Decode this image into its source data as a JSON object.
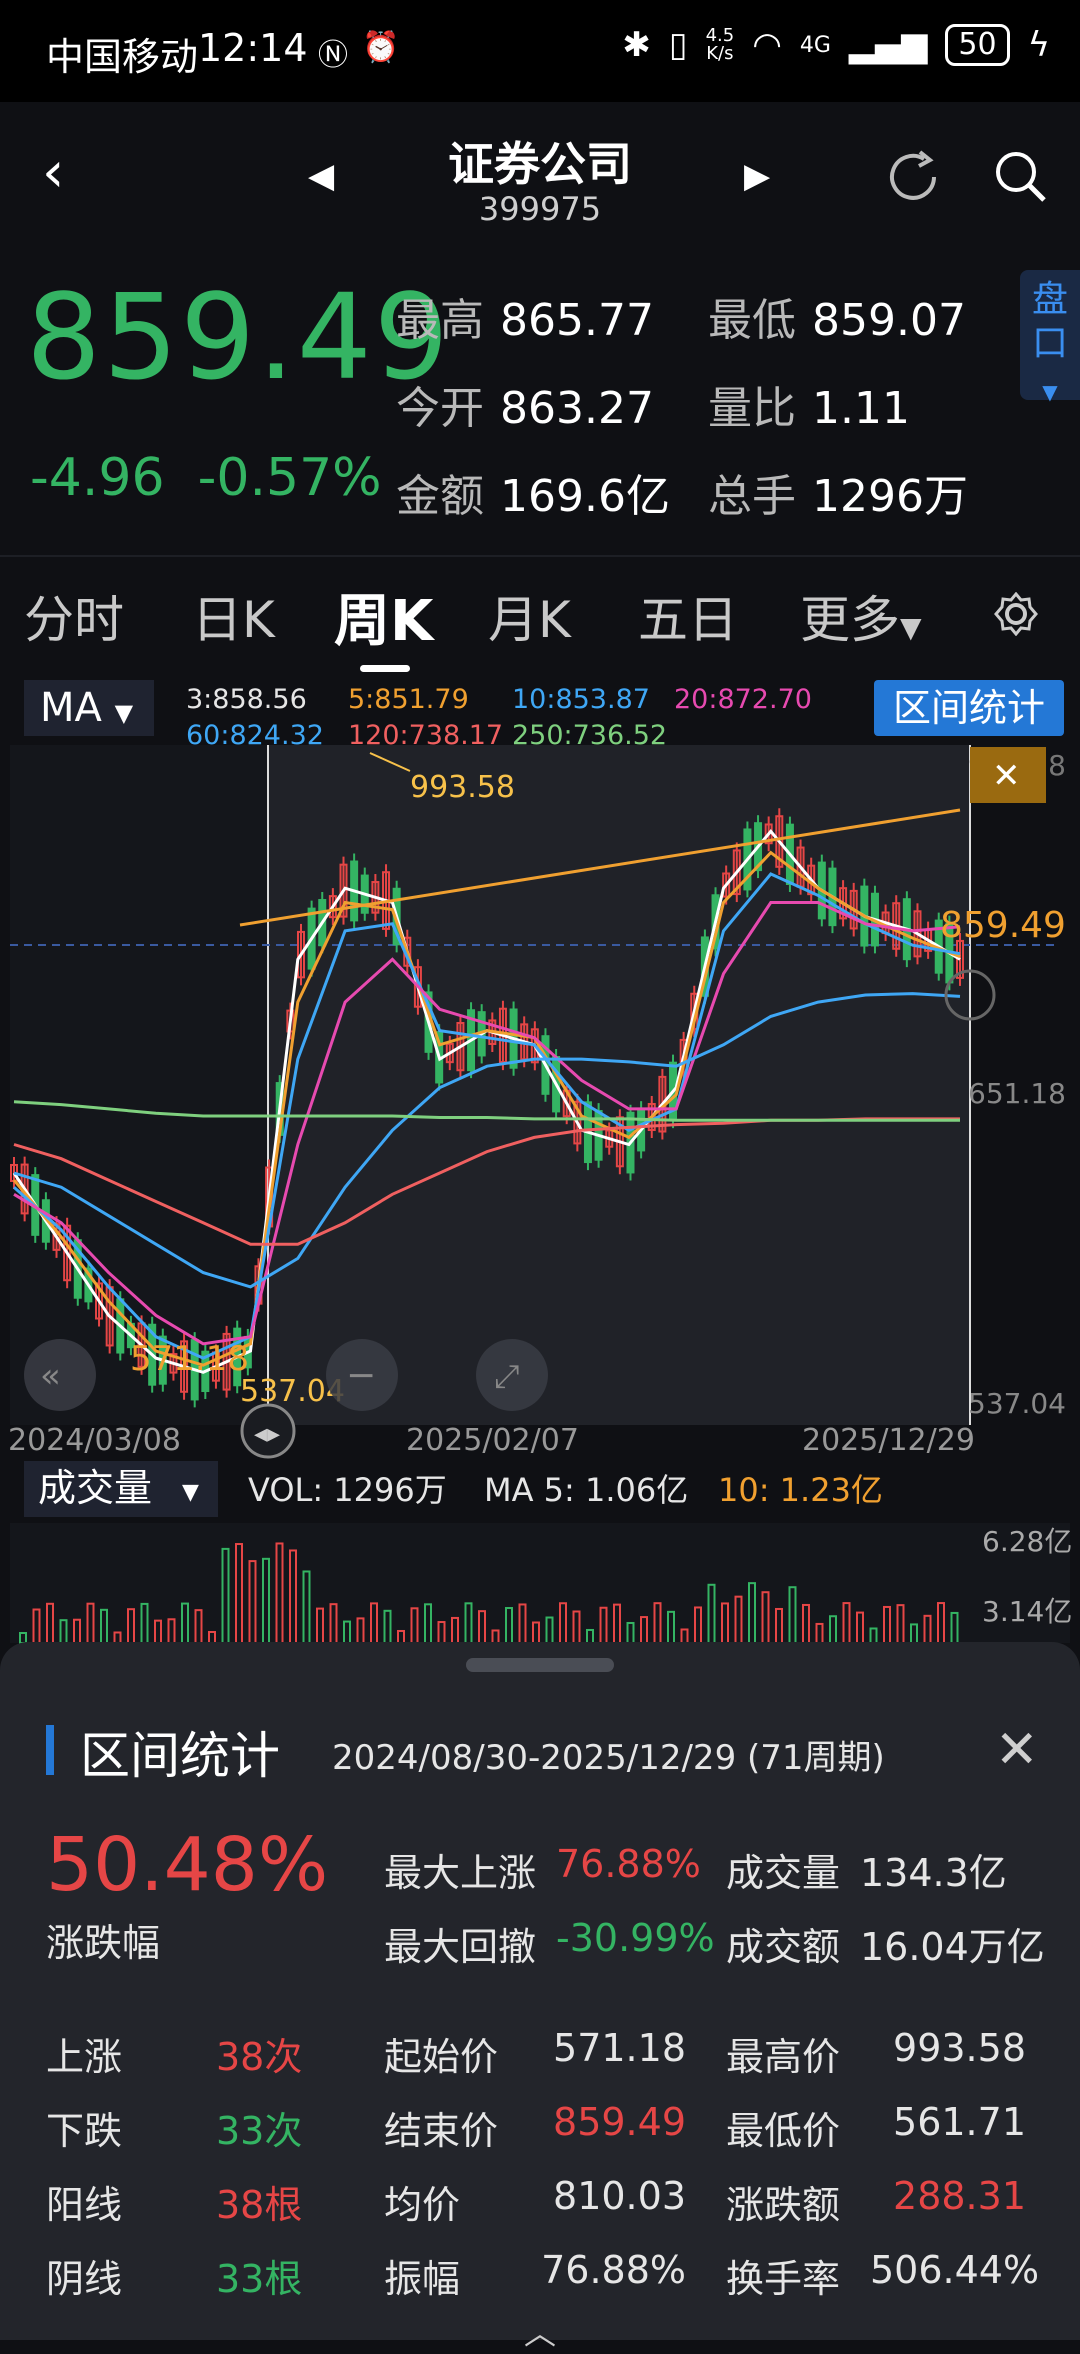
{
  "status": {
    "carrier": "中国移动",
    "time": "12:14",
    "speed_top": "4.5",
    "speed_bottom": "K/s",
    "network": "4G",
    "battery": "50"
  },
  "header": {
    "title": "证券公司",
    "code": "399975",
    "price": "859.49",
    "change": "-4.96",
    "change_pct": "-0.57%",
    "stats": [
      {
        "label": "最高",
        "value": "865.77"
      },
      {
        "label": "最低",
        "value": "859.07"
      },
      {
        "label": "今开",
        "value": "863.27"
      },
      {
        "label": "量比",
        "value": "1.11"
      },
      {
        "label": "金额",
        "value": "169.6亿"
      },
      {
        "label": "总手",
        "value": "1296万"
      }
    ],
    "pankou": "盘口"
  },
  "tabs": [
    "分时",
    "日K",
    "周K",
    "月K",
    "五日",
    "更多"
  ],
  "ma": {
    "selector": "MA",
    "values": [
      {
        "text": "3:858.56",
        "color": "#ffffff"
      },
      {
        "text": "5:851.79",
        "color": "#f0a030"
      },
      {
        "text": "10:853.87",
        "color": "#3fa7f5"
      },
      {
        "text": "20:872.70",
        "color": "#e74ab0"
      },
      {
        "text": "60:824.32",
        "color": "#3fa7f5"
      },
      {
        "text": "120:738.17",
        "color": "#f06060"
      },
      {
        "text": "250:736.52",
        "color": "#7fd07f"
      }
    ],
    "range_button": "区间统计"
  },
  "chart_data": {
    "type": "line",
    "title": "",
    "x": [
      "2024/03/08",
      "2025/02/07",
      "2025/12/29"
    ],
    "y_ticks": [
      "993.58",
      "651.18",
      "537.04"
    ],
    "ylim": [
      537.04,
      993.58
    ],
    "current_label": "859.49",
    "annotations": [
      "993.58",
      "571.18",
      "537.04"
    ],
    "series": [
      {
        "name": "3",
        "color": "#ffffff",
        "values": [
          700,
          650,
          600,
          570,
          560,
          575,
          850,
          900,
          890,
          780,
          800,
          790,
          730,
          720,
          760,
          900,
          940,
          900,
          880,
          870,
          850
        ]
      },
      {
        "name": "5",
        "color": "#f0a030",
        "values": [
          695,
          655,
          610,
          575,
          565,
          580,
          820,
          890,
          885,
          790,
          800,
          795,
          740,
          725,
          755,
          890,
          925,
          900,
          880,
          865,
          852
        ]
      },
      {
        "name": "10",
        "color": "#3fa7f5",
        "values": [
          690,
          660,
          620,
          585,
          570,
          585,
          780,
          870,
          875,
          800,
          795,
          790,
          750,
          730,
          745,
          870,
          910,
          895,
          875,
          860,
          854
        ]
      },
      {
        "name": "20",
        "color": "#e74ab0",
        "values": [
          685,
          665,
          630,
          600,
          580,
          585,
          720,
          820,
          850,
          815,
          805,
          795,
          765,
          745,
          745,
          840,
          890,
          890,
          875,
          870,
          873
        ]
      },
      {
        "name": "60",
        "color": "#3fa7f5",
        "values": [
          700,
          690,
          670,
          650,
          630,
          620,
          640,
          690,
          730,
          760,
          775,
          780,
          780,
          778,
          775,
          790,
          810,
          820,
          825,
          826,
          824
        ]
      },
      {
        "name": "120",
        "color": "#f06060",
        "values": [
          720,
          710,
          695,
          680,
          665,
          650,
          650,
          665,
          685,
          700,
          715,
          725,
          730,
          732,
          734,
          735,
          737,
          737,
          738,
          738,
          738
        ]
      },
      {
        "name": "250",
        "color": "#7fd07f",
        "values": [
          750,
          748,
          745,
          742,
          740,
          740,
          740,
          740,
          740,
          739,
          739,
          738,
          738,
          738,
          737,
          737,
          737,
          737,
          737,
          737,
          737
        ]
      }
    ]
  },
  "volume": {
    "selector": "成交量",
    "vol": "VOL:  1296万",
    "ma5": "MA 5: 1.06亿",
    "ma10": "10: 1.23亿",
    "ticks": [
      "6.28亿",
      "3.14亿"
    ]
  },
  "sheet": {
    "title": "区间统计",
    "range": "2024/08/30-2025/12/29 (71周期)",
    "big_pct": "50.48%",
    "big_label": "涨跌幅",
    "row1": [
      {
        "label": "最大上涨",
        "value": "76.88%"
      },
      {
        "label": "成交量",
        "value": "134.3亿"
      }
    ],
    "row2": [
      {
        "label": "最大回撤",
        "value": "-30.99%"
      },
      {
        "label": "成交额",
        "value": "16.04万亿"
      }
    ],
    "grid": [
      {
        "l1": "上涨",
        "v1": "38次",
        "l2": "起始价",
        "v2": "571.18",
        "l3": "最高价",
        "v3": "993.58"
      },
      {
        "l1": "下跌",
        "v1": "33次",
        "l2": "结束价",
        "v2": "859.49",
        "l3": "最低价",
        "v3": "561.71"
      },
      {
        "l1": "阳线",
        "v1": "38根",
        "l2": "均价",
        "v2": "810.03",
        "l3": "涨跌额",
        "v3": "288.31"
      },
      {
        "l1": "阴线",
        "v1": "33根",
        "l2": "振幅",
        "v2": "76.88%",
        "l3": "换手率",
        "v3": "506.44%"
      }
    ]
  },
  "colors": {
    "up": "#e64646",
    "down": "#34b463",
    "accent": "#2478d6"
  }
}
